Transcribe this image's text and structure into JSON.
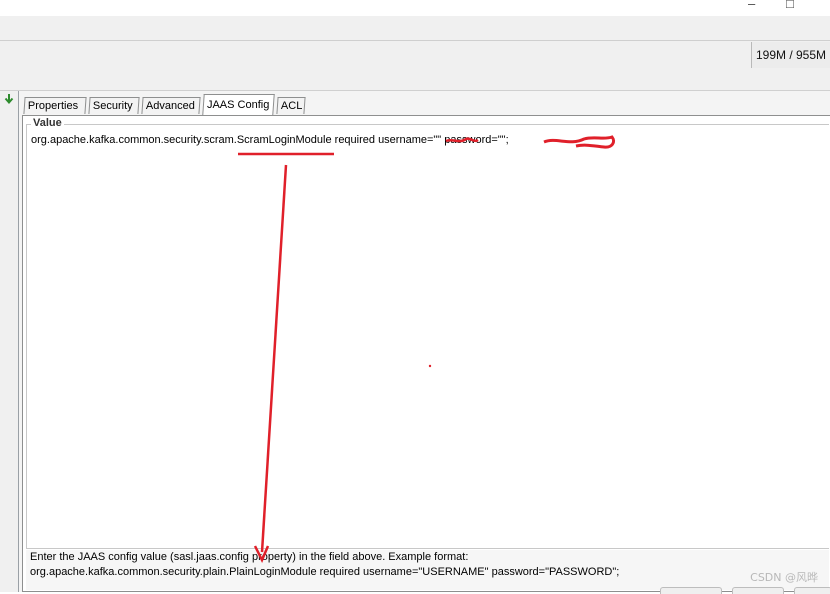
{
  "window": {
    "minimize_glyph": "–",
    "maximize_glyph": "□"
  },
  "status": {
    "memory": "199M / 955M"
  },
  "tabs": [
    {
      "label": "Properties",
      "active": false
    },
    {
      "label": "Security",
      "active": false
    },
    {
      "label": "Advanced",
      "active": false
    },
    {
      "label": "JAAS Config",
      "active": true
    },
    {
      "label": "ACL",
      "active": false
    }
  ],
  "value_group": {
    "title": "Value",
    "text": "org.apache.kafka.common.security.scram.ScramLoginModule required username=\"\" password=\"\";"
  },
  "help": {
    "line1": "Enter the JAAS config value (sasl.jaas.config property) in the field above. Example format:",
    "line2": "org.apache.kafka.common.security.plain.PlainLoginModule required username=\"USERNAME\" password=\"PASSWORD\";"
  },
  "watermark": "CSDN @风晔",
  "icons": {
    "expand": "expand-arrow-icon"
  },
  "colors": {
    "annotation_red": "#e0202a",
    "tab_border": "#8e8f8f"
  }
}
